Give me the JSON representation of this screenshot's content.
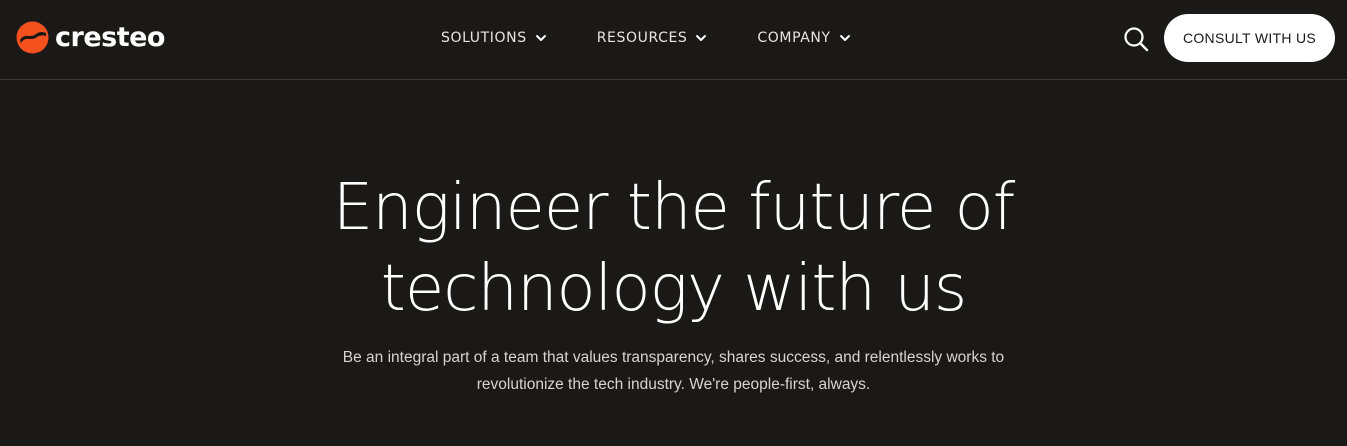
{
  "brand": {
    "name": "cresteo",
    "accent_color": "#f4511e"
  },
  "nav": {
    "items": [
      {
        "label": "SOLUTIONS",
        "icon": "chevron-down-icon"
      },
      {
        "label": "RESOURCES",
        "icon": "chevron-down-icon"
      },
      {
        "label": "COMPANY",
        "icon": "chevron-down-icon"
      }
    ]
  },
  "header": {
    "search_icon": "search-icon",
    "cta_label": "CONSULT WITH US"
  },
  "hero": {
    "title_line1": "Engineer the future of",
    "title_line2": "technology with us",
    "subtitle_line1": "Be an integral part of a team that values transparency, shares success, and relentlessly works to",
    "subtitle_line2": "revolutionize the tech industry. We're people-first, always."
  },
  "colors": {
    "background": "#1b1918",
    "text": "#ffffff",
    "muted_text": "#d9d3cc"
  }
}
